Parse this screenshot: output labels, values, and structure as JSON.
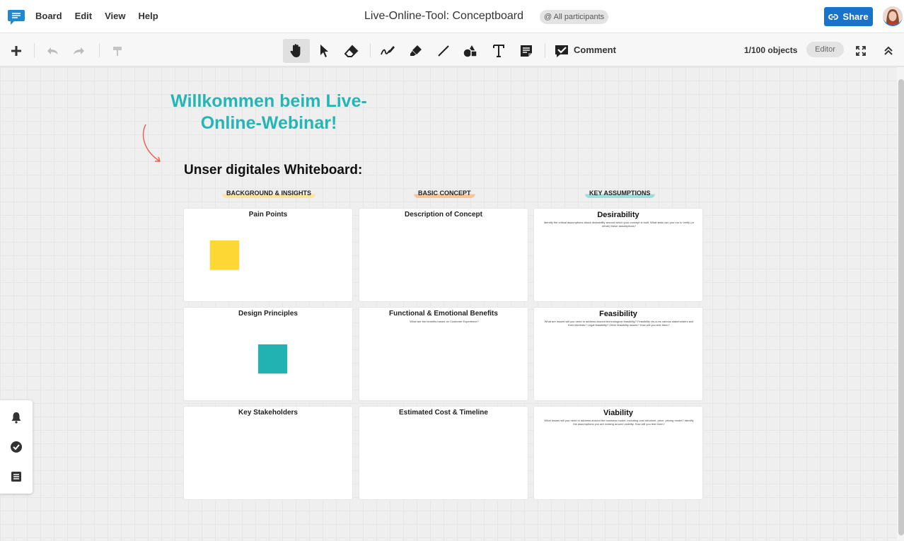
{
  "header": {
    "menu": [
      "Board",
      "Edit",
      "View",
      "Help"
    ],
    "board_title": "Live-Online-Tool: Conceptboard",
    "participants_label": "@ All participants",
    "share_label": "Share"
  },
  "toolbar": {
    "comment_label": "Comment",
    "object_count": "1/100 objects",
    "role_badge": "Editor"
  },
  "board": {
    "welcome_text": "Willkommen beim Live-Online-Webinar!",
    "whiteboard_title": "Unser digitales Whiteboard:",
    "columns": [
      "BACKGROUND & INSIGHTS",
      "BASIC CONCEPT",
      "KEY ASSUMPTIONS"
    ],
    "cards": [
      {
        "title": "Pain Points",
        "desc": ""
      },
      {
        "title": "Description of Concept",
        "desc": ""
      },
      {
        "title": "Desirability",
        "desc": "Identify the critical assumptions about desirability around which your concept is built. What tests can you run to verify (or refute) these assumptions?"
      },
      {
        "title": "Design Principles",
        "desc": ""
      },
      {
        "title": "Functional & Emotional Benefits",
        "desc": "What are the benefits based on Customer Experience?"
      },
      {
        "title": "Feasibility",
        "desc": "What are issues will you need to address around technological feasibility? Feasibility vis-a-vis various stakeholders and their interests? Legal feasibility? Other feasibility issues? How will you test them?"
      },
      {
        "title": "Key Stakeholders",
        "desc": ""
      },
      {
        "title": "Estimated Cost & Timeline",
        "desc": ""
      },
      {
        "title": "Viability",
        "desc": "What issues will you need to address around the business model, including cost structure, price, pricing model? Identify the assumptions you are making around viability. How will you test them?"
      }
    ]
  },
  "colors": {
    "accent_teal": "#26b5b5",
    "share_blue": "#1a73c9",
    "sticky_yellow": "#fdd835",
    "sticky_teal": "#23b2b2",
    "arrow_red": "#f05a4f"
  },
  "icons": {
    "toolbar": [
      "plus-icon",
      "undo-icon",
      "redo-icon",
      "format-painter-icon",
      "hand-icon",
      "pointer-icon",
      "eraser-icon",
      "pen-icon",
      "highlighter-icon",
      "line-icon",
      "shapes-icon",
      "text-icon",
      "sticky-note-icon",
      "comment-icon",
      "fullscreen-icon",
      "collapse-icon"
    ],
    "side": [
      "bell-icon",
      "check-circle-icon",
      "list-icon"
    ]
  }
}
